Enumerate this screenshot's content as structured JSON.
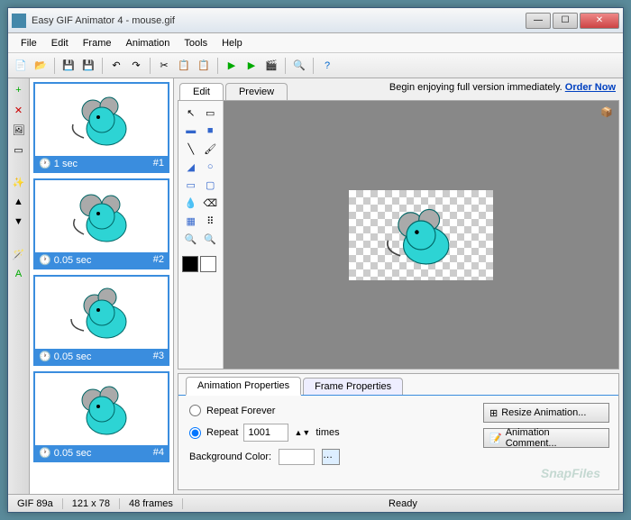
{
  "window": {
    "title": "Easy GIF Animator 4 - mouse.gif"
  },
  "menu": {
    "items": [
      "File",
      "Edit",
      "Frame",
      "Animation",
      "Tools",
      "Help"
    ]
  },
  "promo": {
    "text": "Begin enjoying full version immediately.",
    "link": "Order Now"
  },
  "tabs": {
    "edit": "Edit",
    "preview": "Preview"
  },
  "frames": [
    {
      "duration": "1 sec",
      "index": "#1"
    },
    {
      "duration": "0.05 sec",
      "index": "#2"
    },
    {
      "duration": "0.05 sec",
      "index": "#3"
    },
    {
      "duration": "0.05 sec",
      "index": "#4"
    }
  ],
  "props": {
    "tab1": "Animation Properties",
    "tab2": "Frame Properties",
    "repeat_forever": "Repeat Forever",
    "repeat": "Repeat",
    "repeat_value": "1001",
    "times": "times",
    "bg_color": "Background Color:",
    "resize": "Resize Animation...",
    "comment": "Animation Comment..."
  },
  "status": {
    "format": "GIF 89a",
    "dims": "121 x 78",
    "frames": "48 frames",
    "ready": "Ready"
  },
  "watermark": "SnapFiles",
  "colors": {
    "accent": "#3a8dde",
    "mouse": "#2dd4d4"
  }
}
